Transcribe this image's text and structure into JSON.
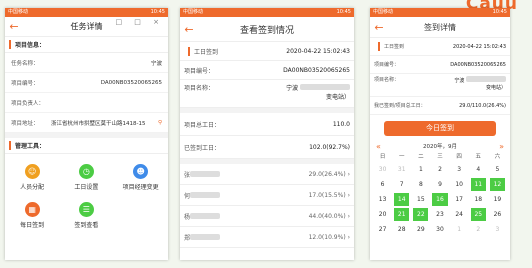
{
  "corner_logo": "Cauu",
  "phone1": {
    "status_left": "中国移动",
    "status_right": "10:45",
    "controls": "□ □ ×",
    "back": "←",
    "title": "任务详情",
    "sections": [
      {
        "title": "项目信息："
      },
      {
        "title": "管理工具："
      }
    ],
    "rows": [
      {
        "label": "任务名称：",
        "value": "宁波"
      },
      {
        "label": "项目编号：",
        "value": "DA00NB03520065265"
      },
      {
        "label": "项目负责人：",
        "value": ""
      },
      {
        "label": "项目地址：",
        "value": "浙江省杭州市拱墅区莫干山路1418-15"
      }
    ],
    "tools": [
      {
        "label": "人员分配",
        "icon": "person-icon",
        "color": "#f0a020"
      },
      {
        "label": "工日设置",
        "icon": "clock-icon",
        "color": "#4ccc44"
      },
      {
        "label": "项目经理变更",
        "icon": "user-icon",
        "color": "#3f8be9"
      },
      {
        "label": "每日签到",
        "icon": "calendar-icon",
        "color": "#ee6a2c"
      },
      {
        "label": "签到查看",
        "icon": "document-icon",
        "color": "#4ccc44"
      }
    ]
  },
  "phone2": {
    "status_left": "中国移动",
    "status_right": "10:45",
    "back": "←",
    "title": "查看签到情况",
    "workday_label": "工日签到",
    "workday_time": "2020-04-22 15:02:43",
    "project_no_label": "项目编号：",
    "project_no": "DA00NB03520065265",
    "project_name_label": "项目名称：",
    "project_name_prefix": "宁波",
    "project_name_suffix": "变电站）",
    "total_label": "项目总工日：",
    "total": "110.0",
    "signed_label": "已签到工日：",
    "signed": "102.0(92.7%)",
    "staff": [
      {
        "name": "张",
        "value": "29.0(26.4%)"
      },
      {
        "name": "何",
        "value": "17.0(15.5%)"
      },
      {
        "name": "杨",
        "value": "44.0(40.0%)"
      },
      {
        "name": "郑",
        "value": "12.0(10.9%)"
      }
    ]
  },
  "phone3": {
    "status_left": "中国移动",
    "status_right": "10:45",
    "back": "←",
    "title": "签到详情",
    "daily_label": "工日签到",
    "daily_time": "2020-04-22 15:02:43",
    "project_no_label": "项目编号：",
    "project_no": "DA00NB03520065265",
    "project_name_label": "项目名称：",
    "project_name_prefix": "宁波",
    "project_name_suffix": "变电站）",
    "ratio_label": "我已签到/项目总工日：",
    "ratio": "29.0/110.0(26.4%)",
    "sign_button": "今日签到",
    "month": "2020年，9月",
    "prev": "«",
    "next": "»",
    "weekdays": [
      "日",
      "一",
      "二",
      "三",
      "四",
      "五",
      "六"
    ],
    "days": [
      {
        "d": "30",
        "s": "mu"
      },
      {
        "d": "31",
        "s": "mu"
      },
      {
        "d": "1",
        "s": ""
      },
      {
        "d": "2",
        "s": ""
      },
      {
        "d": "3",
        "s": ""
      },
      {
        "d": "4",
        "s": ""
      },
      {
        "d": "5",
        "s": ""
      },
      {
        "d": "6",
        "s": ""
      },
      {
        "d": "7",
        "s": ""
      },
      {
        "d": "8",
        "s": ""
      },
      {
        "d": "9",
        "s": ""
      },
      {
        "d": "10",
        "s": ""
      },
      {
        "d": "11",
        "s": "on"
      },
      {
        "d": "12",
        "s": "on"
      },
      {
        "d": "13",
        "s": ""
      },
      {
        "d": "14",
        "s": "on"
      },
      {
        "d": "15",
        "s": ""
      },
      {
        "d": "16",
        "s": "on"
      },
      {
        "d": "17",
        "s": ""
      },
      {
        "d": "18",
        "s": ""
      },
      {
        "d": "19",
        "s": ""
      },
      {
        "d": "20",
        "s": ""
      },
      {
        "d": "21",
        "s": "on"
      },
      {
        "d": "22",
        "s": "on"
      },
      {
        "d": "23",
        "s": ""
      },
      {
        "d": "24",
        "s": ""
      },
      {
        "d": "25",
        "s": "on"
      },
      {
        "d": "26",
        "s": ""
      },
      {
        "d": "27",
        "s": ""
      },
      {
        "d": "28",
        "s": ""
      },
      {
        "d": "29",
        "s": ""
      },
      {
        "d": "30",
        "s": ""
      },
      {
        "d": "1",
        "s": "mu"
      },
      {
        "d": "2",
        "s": "mu"
      },
      {
        "d": "3",
        "s": "mu"
      }
    ]
  }
}
